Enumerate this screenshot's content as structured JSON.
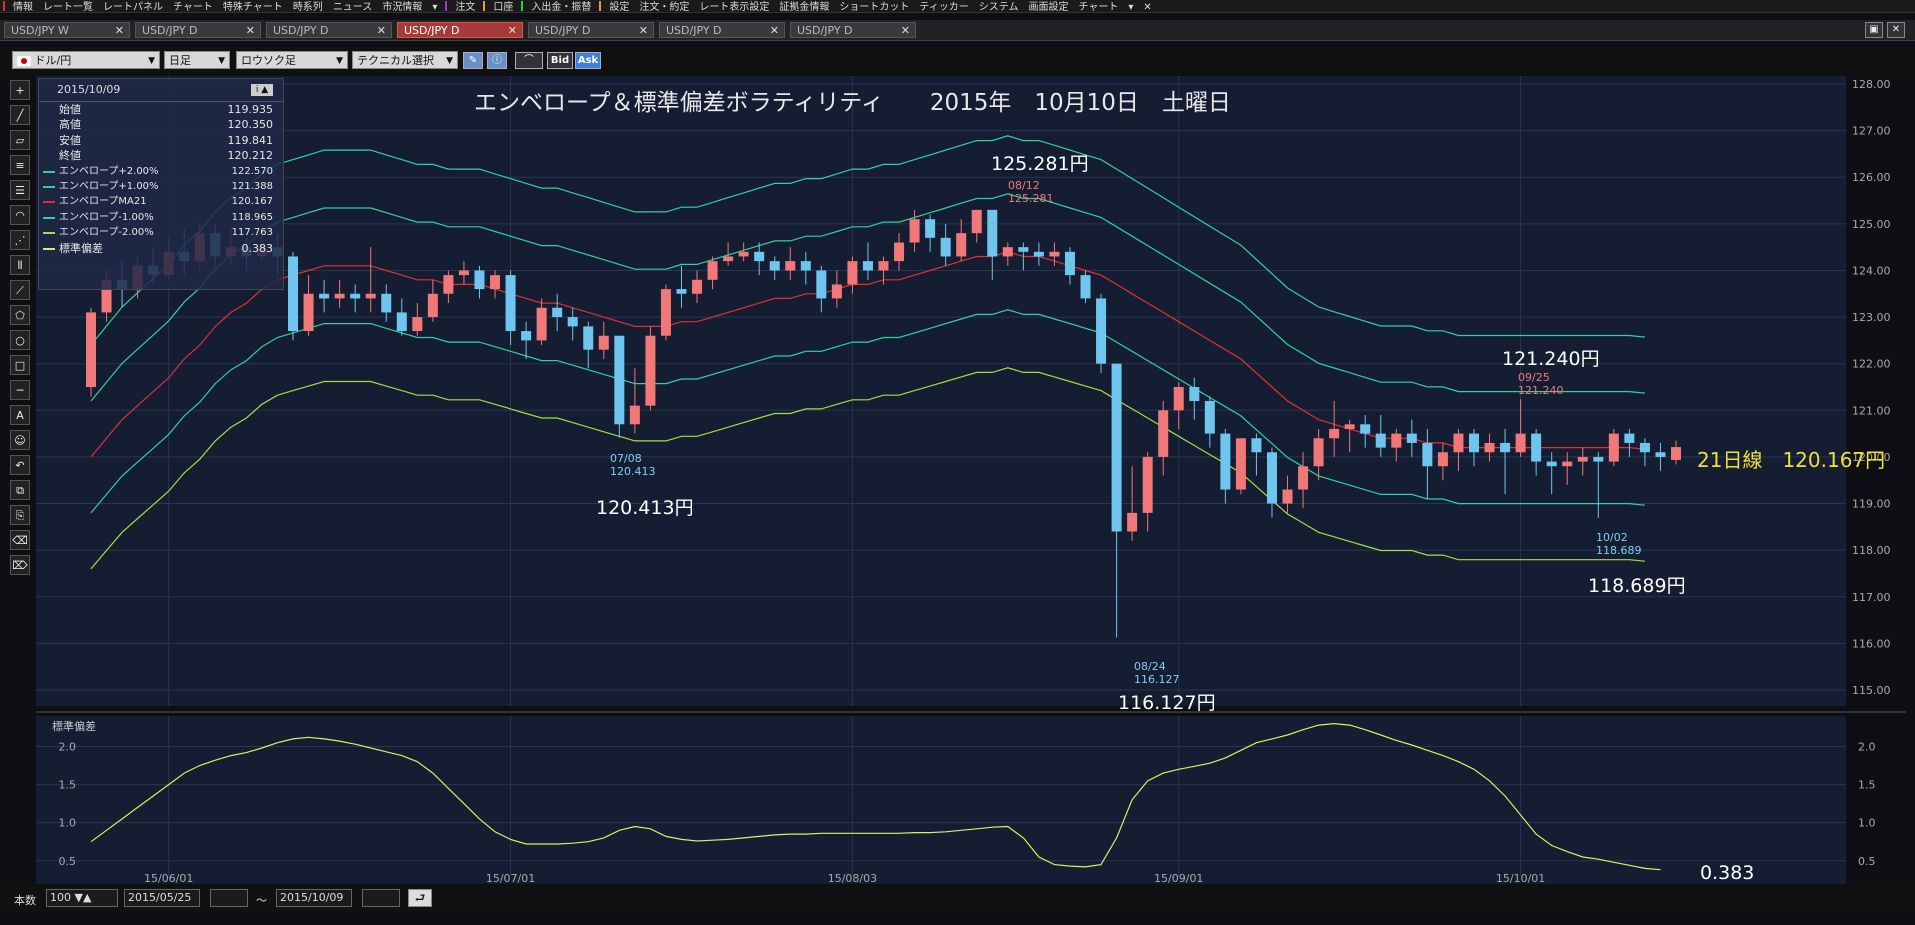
{
  "menubar": {
    "items": [
      {
        "label": "情報",
        "sep": "#d33"
      },
      {
        "label": "レート一覧"
      },
      {
        "label": "レートパネル"
      },
      {
        "label": "チャート"
      },
      {
        "label": "特殊チャート"
      },
      {
        "label": "時系列"
      },
      {
        "label": "ニュース"
      },
      {
        "label": "市況情報"
      },
      {
        "label": "▾"
      },
      {
        "label": "注文",
        "sep": "#a3c"
      },
      {
        "label": "口座",
        "sep": "#e93"
      },
      {
        "label": "入出金・振替",
        "sep": "#3c3"
      },
      {
        "label": "設定",
        "sep": "#e93"
      },
      {
        "label": "注文・約定"
      },
      {
        "label": "レート表示設定"
      },
      {
        "label": "証拠金情報"
      },
      {
        "label": "ショートカット"
      },
      {
        "label": "ティッカー"
      },
      {
        "label": "システム"
      },
      {
        "label": "画面設定"
      },
      {
        "label": "チャート"
      },
      {
        "label": "▾"
      },
      {
        "label": "✕"
      }
    ]
  },
  "tabs": [
    {
      "label": "USD/JPY W",
      "active": false
    },
    {
      "label": "USD/JPY D",
      "active": false
    },
    {
      "label": "USD/JPY D",
      "active": false
    },
    {
      "label": "USD/JPY D",
      "active": true
    },
    {
      "label": "USD/JPY D",
      "active": false
    },
    {
      "label": "USD/JPY D",
      "active": false
    },
    {
      "label": "USD/JPY D",
      "active": false
    }
  ],
  "toolbar": {
    "pair": "ドル/円",
    "period": "日足",
    "chart_type": "ロウソク足",
    "technical": "テクニカル選択",
    "bid": "Bid",
    "ask": "Ask"
  },
  "info": {
    "date": "2015/10/09",
    "rows": [
      {
        "label": "始値",
        "value": "119.935"
      },
      {
        "label": "高値",
        "value": "120.350"
      },
      {
        "label": "安値",
        "value": "119.841"
      },
      {
        "label": "終値",
        "value": "120.212"
      },
      {
        "label": "エンベロープ+2.00%",
        "value": "122.570",
        "color": "#2fd39a"
      },
      {
        "label": "エンベロープ+1.00%",
        "value": "121.388",
        "color": "#2fd39a"
      },
      {
        "label": "エンベロープMA21",
        "value": "120.167",
        "color": "#e03030"
      },
      {
        "label": "エンベロープ-1.00%",
        "value": "118.965",
        "color": "#2fd39a"
      },
      {
        "label": "エンベロープ-2.00%",
        "value": "117.763",
        "color": "#9fe040"
      },
      {
        "label": "標準偏差",
        "value": "0.383",
        "color": "#d8f060"
      }
    ]
  },
  "annotations": {
    "title": "エンベロープ＆標準偏差ボラティリティ　　2015年　10月10日　土曜日",
    "high_label": "125.281円",
    "low_label": "116.127円",
    "left_low_label": "120.413円",
    "right_high_label": "121.240円",
    "right_low_label": "118.689円",
    "ma_label": "21日線　120.167円",
    "stdev_label": "0.383",
    "marker_0812_date": "08/12",
    "marker_0812_val": "125.281",
    "marker_0708_date": "07/08",
    "marker_0708_val": "120.413",
    "marker_0824_date": "08/24",
    "marker_0824_val": "116.127",
    "marker_0925_date": "09/25",
    "marker_0925_val": "121.240",
    "marker_1002_date": "10/02",
    "marker_1002_val": "118.689"
  },
  "colors": {
    "up": "#f07878",
    "down": "#6ec6ee",
    "ma": "#e03030",
    "env1": "#2fd39a",
    "env2": "#9fe040",
    "stdev": "#d8f060"
  },
  "chart_data": {
    "type": "candlestick",
    "xlabels": [
      "15/06/01",
      "15/07/01",
      "15/08/03",
      "15/09/01",
      "15/10/01"
    ],
    "price_ylim": [
      115,
      128
    ],
    "price_ticks": [
      "128.00",
      "127.00",
      "126.00",
      "125.00",
      "124.00",
      "123.00",
      "122.00",
      "121.00",
      "120.00",
      "119.00",
      "118.00",
      "117.00",
      "116.00",
      "115.00"
    ],
    "sub_title": "標準偏差",
    "sub_ylim": [
      0.3,
      2.4
    ],
    "sub_ticks": [
      "2.0",
      "1.5",
      "1.0",
      "0.5"
    ],
    "candles": [
      [
        121.5,
        123.1,
        123.2,
        121.3
      ],
      [
        123.1,
        123.8,
        124.0,
        122.9
      ],
      [
        123.8,
        123.6,
        124.2,
        123.2
      ],
      [
        123.6,
        124.1,
        124.3,
        123.4
      ],
      [
        124.1,
        123.9,
        124.5,
        123.7
      ],
      [
        123.9,
        124.4,
        124.7,
        123.8
      ],
      [
        124.4,
        124.2,
        124.9,
        123.9
      ],
      [
        124.2,
        124.8,
        125.0,
        124.0
      ],
      [
        124.8,
        124.3,
        125.0,
        124.1
      ],
      [
        124.3,
        124.5,
        124.9,
        124.1
      ],
      [
        124.5,
        124.3,
        124.7,
        124.0
      ],
      [
        124.3,
        124.5,
        124.9,
        124.2
      ],
      [
        124.5,
        124.3,
        124.8,
        123.9
      ],
      [
        124.3,
        122.7,
        124.4,
        122.5
      ],
      [
        122.7,
        123.5,
        123.9,
        122.6
      ],
      [
        123.5,
        123.4,
        123.8,
        123.1
      ],
      [
        123.4,
        123.5,
        123.8,
        123.2
      ],
      [
        123.5,
        123.4,
        123.7,
        123.1
      ],
      [
        123.4,
        123.5,
        124.5,
        123.1
      ],
      [
        123.5,
        123.1,
        123.7,
        122.9
      ],
      [
        123.1,
        122.7,
        123.4,
        122.6
      ],
      [
        122.7,
        123.0,
        123.3,
        122.6
      ],
      [
        123.0,
        123.5,
        123.8,
        122.9
      ],
      [
        123.5,
        123.9,
        124.0,
        123.3
      ],
      [
        123.9,
        124.0,
        124.2,
        123.7
      ],
      [
        124.0,
        123.6,
        124.1,
        123.4
      ],
      [
        123.6,
        123.9,
        124.0,
        123.4
      ],
      [
        123.9,
        122.7,
        124.0,
        122.4
      ],
      [
        122.7,
        122.5,
        122.9,
        122.1
      ],
      [
        122.5,
        123.2,
        123.4,
        122.4
      ],
      [
        123.2,
        123.0,
        123.5,
        122.7
      ],
      [
        123.0,
        122.8,
        123.2,
        122.5
      ],
      [
        122.8,
        122.3,
        122.9,
        121.9
      ],
      [
        122.3,
        122.6,
        122.9,
        122.1
      ],
      [
        122.6,
        120.7,
        122.6,
        120.413
      ],
      [
        120.7,
        121.1,
        121.9,
        120.5
      ],
      [
        121.1,
        122.6,
        122.8,
        121.0
      ],
      [
        122.6,
        123.6,
        123.7,
        122.5
      ],
      [
        123.6,
        123.5,
        124.1,
        123.2
      ],
      [
        123.5,
        123.8,
        124.0,
        123.3
      ],
      [
        123.8,
        124.2,
        124.3,
        123.6
      ],
      [
        124.2,
        124.3,
        124.6,
        124.1
      ],
      [
        124.3,
        124.4,
        124.6,
        124.2
      ],
      [
        124.4,
        124.2,
        124.6,
        123.9
      ],
      [
        124.2,
        124.0,
        124.3,
        123.8
      ],
      [
        124.0,
        124.2,
        124.5,
        123.8
      ],
      [
        124.2,
        124.0,
        124.4,
        123.7
      ],
      [
        124.0,
        123.4,
        124.1,
        123.1
      ],
      [
        123.4,
        123.7,
        124.0,
        123.2
      ],
      [
        123.7,
        124.2,
        124.3,
        123.5
      ],
      [
        124.2,
        124.0,
        124.6,
        123.8
      ],
      [
        124.0,
        124.2,
        124.3,
        123.7
      ],
      [
        124.2,
        124.6,
        124.8,
        124.0
      ],
      [
        124.6,
        125.1,
        125.3,
        124.4
      ],
      [
        125.1,
        124.7,
        125.2,
        124.4
      ],
      [
        124.7,
        124.3,
        125.0,
        124.1
      ],
      [
        124.3,
        124.8,
        125.1,
        124.2
      ],
      [
        124.8,
        125.3,
        125.281,
        124.6
      ],
      [
        125.3,
        124.3,
        125.3,
        123.8
      ],
      [
        124.3,
        124.5,
        124.6,
        124.1
      ],
      [
        124.5,
        124.4,
        124.6,
        124.0
      ],
      [
        124.4,
        124.3,
        124.6,
        124.1
      ],
      [
        124.3,
        124.4,
        124.6,
        124.1
      ],
      [
        124.4,
        123.9,
        124.5,
        123.7
      ],
      [
        123.9,
        123.4,
        124.0,
        123.3
      ],
      [
        123.4,
        122.0,
        123.5,
        121.8
      ],
      [
        122.0,
        118.4,
        122.0,
        116.127
      ],
      [
        118.4,
        118.8,
        119.8,
        118.2
      ],
      [
        118.8,
        120.0,
        120.1,
        118.4
      ],
      [
        120.0,
        121.0,
        121.2,
        119.6
      ],
      [
        121.0,
        121.5,
        121.6,
        120.6
      ],
      [
        121.5,
        121.2,
        121.7,
        120.8
      ],
      [
        121.2,
        120.5,
        121.3,
        120.2
      ],
      [
        120.5,
        119.3,
        120.6,
        119.0
      ],
      [
        119.3,
        120.4,
        120.4,
        119.2
      ],
      [
        120.4,
        120.1,
        120.5,
        119.6
      ],
      [
        120.1,
        119.0,
        120.2,
        118.7
      ],
      [
        119.0,
        119.3,
        119.6,
        118.8
      ],
      [
        119.3,
        119.8,
        120.1,
        118.9
      ],
      [
        119.8,
        120.4,
        120.6,
        119.5
      ],
      [
        120.4,
        120.6,
        121.2,
        120.0
      ],
      [
        120.6,
        120.7,
        120.8,
        120.1
      ],
      [
        120.7,
        120.5,
        120.9,
        120.2
      ],
      [
        120.5,
        120.2,
        120.9,
        120.0
      ],
      [
        120.2,
        120.5,
        120.6,
        119.9
      ],
      [
        120.5,
        120.3,
        120.8,
        120.0
      ],
      [
        120.3,
        119.8,
        120.6,
        119.1
      ],
      [
        119.8,
        120.1,
        120.3,
        119.5
      ],
      [
        120.1,
        120.5,
        120.6,
        119.7
      ],
      [
        120.5,
        120.1,
        120.6,
        119.8
      ],
      [
        120.1,
        120.3,
        120.5,
        119.9
      ],
      [
        120.3,
        120.1,
        120.6,
        119.2
      ],
      [
        120.1,
        120.5,
        121.24,
        120.0
      ],
      [
        120.5,
        119.9,
        120.6,
        119.6
      ],
      [
        119.9,
        119.8,
        120.1,
        119.2
      ],
      [
        119.8,
        119.9,
        120.1,
        119.4
      ],
      [
        119.9,
        120.0,
        120.2,
        119.6
      ],
      [
        120.0,
        119.9,
        120.1,
        118.689
      ],
      [
        119.9,
        120.5,
        120.6,
        119.8
      ],
      [
        120.5,
        120.3,
        120.6,
        120.0
      ],
      [
        120.3,
        120.1,
        120.4,
        119.8
      ],
      [
        120.1,
        120.0,
        120.3,
        119.7
      ],
      [
        119.935,
        120.212,
        120.35,
        119.841
      ]
    ],
    "ma21": [
      120.0,
      120.4,
      120.8,
      121.1,
      121.4,
      121.7,
      122.1,
      122.4,
      122.8,
      123.1,
      123.3,
      123.6,
      123.8,
      123.9,
      124.0,
      124.1,
      124.1,
      124.1,
      124.1,
      124.0,
      123.9,
      123.8,
      123.8,
      123.7,
      123.7,
      123.7,
      123.6,
      123.5,
      123.4,
      123.3,
      123.3,
      123.2,
      123.1,
      123.0,
      122.9,
      122.8,
      122.8,
      122.8,
      122.9,
      122.9,
      123.0,
      123.1,
      123.2,
      123.3,
      123.4,
      123.4,
      123.5,
      123.5,
      123.6,
      123.7,
      123.7,
      123.8,
      123.8,
      123.9,
      124.0,
      124.1,
      124.2,
      124.3,
      124.3,
      124.4,
      124.3,
      124.3,
      124.2,
      124.1,
      124.0,
      123.9,
      123.7,
      123.5,
      123.3,
      123.1,
      122.9,
      122.7,
      122.5,
      122.3,
      122.1,
      121.8,
      121.5,
      121.2,
      121.0,
      120.8,
      120.7,
      120.6,
      120.5,
      120.4,
      120.4,
      120.4,
      120.3,
      120.3,
      120.2,
      120.2,
      120.2,
      120.2,
      120.2,
      120.2,
      120.2,
      120.2,
      120.2,
      120.2,
      120.2,
      120.2,
      120.167
    ],
    "stdev": [
      0.75,
      0.9,
      1.05,
      1.2,
      1.35,
      1.5,
      1.65,
      1.75,
      1.82,
      1.88,
      1.92,
      1.98,
      2.05,
      2.1,
      2.12,
      2.1,
      2.07,
      2.03,
      1.98,
      1.93,
      1.88,
      1.8,
      1.65,
      1.45,
      1.25,
      1.05,
      0.88,
      0.78,
      0.72,
      0.72,
      0.72,
      0.73,
      0.75,
      0.8,
      0.9,
      0.95,
      0.92,
      0.82,
      0.78,
      0.76,
      0.77,
      0.78,
      0.8,
      0.82,
      0.84,
      0.85,
      0.85,
      0.86,
      0.86,
      0.86,
      0.86,
      0.86,
      0.86,
      0.87,
      0.87,
      0.88,
      0.9,
      0.92,
      0.94,
      0.95,
      0.8,
      0.55,
      0.45,
      0.43,
      0.42,
      0.45,
      0.8,
      1.3,
      1.55,
      1.65,
      1.7,
      1.74,
      1.78,
      1.85,
      1.95,
      2.05,
      2.1,
      2.15,
      2.22,
      2.28,
      2.3,
      2.28,
      2.22,
      2.15,
      2.08,
      2.02,
      1.95,
      1.88,
      1.8,
      1.7,
      1.55,
      1.35,
      1.1,
      0.85,
      0.7,
      0.62,
      0.55,
      0.52,
      0.48,
      0.44,
      0.4,
      0.383
    ]
  }
}
